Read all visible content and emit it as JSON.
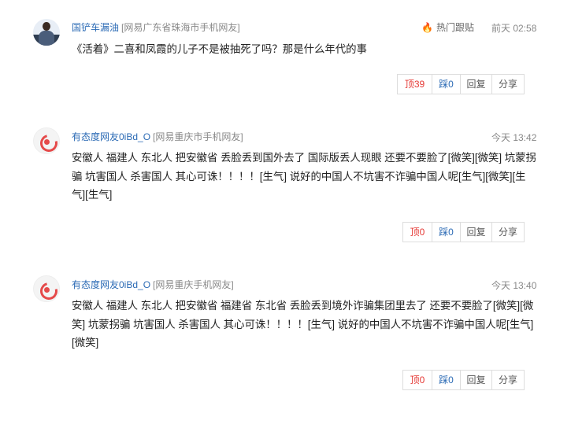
{
  "comments": [
    {
      "username": "国铲车漏油",
      "location": "[网易广东省珠海市手机网友]",
      "hot_label": "热门跟贴",
      "time": "前天 02:58",
      "content": "《活着》二喜和凤霞的儿子不是被抽死了吗？那是什么年代的事",
      "up_label": "顶39",
      "down_label": "踩0",
      "reply_label": "回复",
      "share_label": "分享"
    },
    {
      "username": "有态度网友0iBd_O",
      "location": "[网易重庆市手机网友]",
      "time": "今天 13:42",
      "content": "安徽人 福建人 东北人 把安徽省 丢脸丢到国外去了 国际版丢人现眼 还要不要脸了[微笑][微笑] 坑蒙拐骗 坑害国人 杀害国人 其心可诛！！！！[生气] 说好的中国人不坑害不诈骗中国人呢[生气][微笑][生气][生气]",
      "up_label": "顶0",
      "down_label": "踩0",
      "reply_label": "回复",
      "share_label": "分享"
    },
    {
      "username": "有态度网友0iBd_O",
      "location": "[网易重庆手机网友]",
      "time": "今天 13:40",
      "content": "安徽人 福建人 东北人 把安徽省 福建省 东北省 丢脸丢到境外诈骗集团里去了 还要不要脸了[微笑][微笑] 坑蒙拐骗 坑害国人 杀害国人 其心可诛！！！！[生气] 说好的中国人不坑害不诈骗中国人呢[生气][微笑]",
      "up_label": "顶0",
      "down_label": "踩0",
      "reply_label": "回复",
      "share_label": "分享"
    }
  ],
  "icons": {
    "hot": "fire-icon",
    "avatar1": "user-photo-avatar",
    "avatar2": "netease-logo-avatar"
  }
}
